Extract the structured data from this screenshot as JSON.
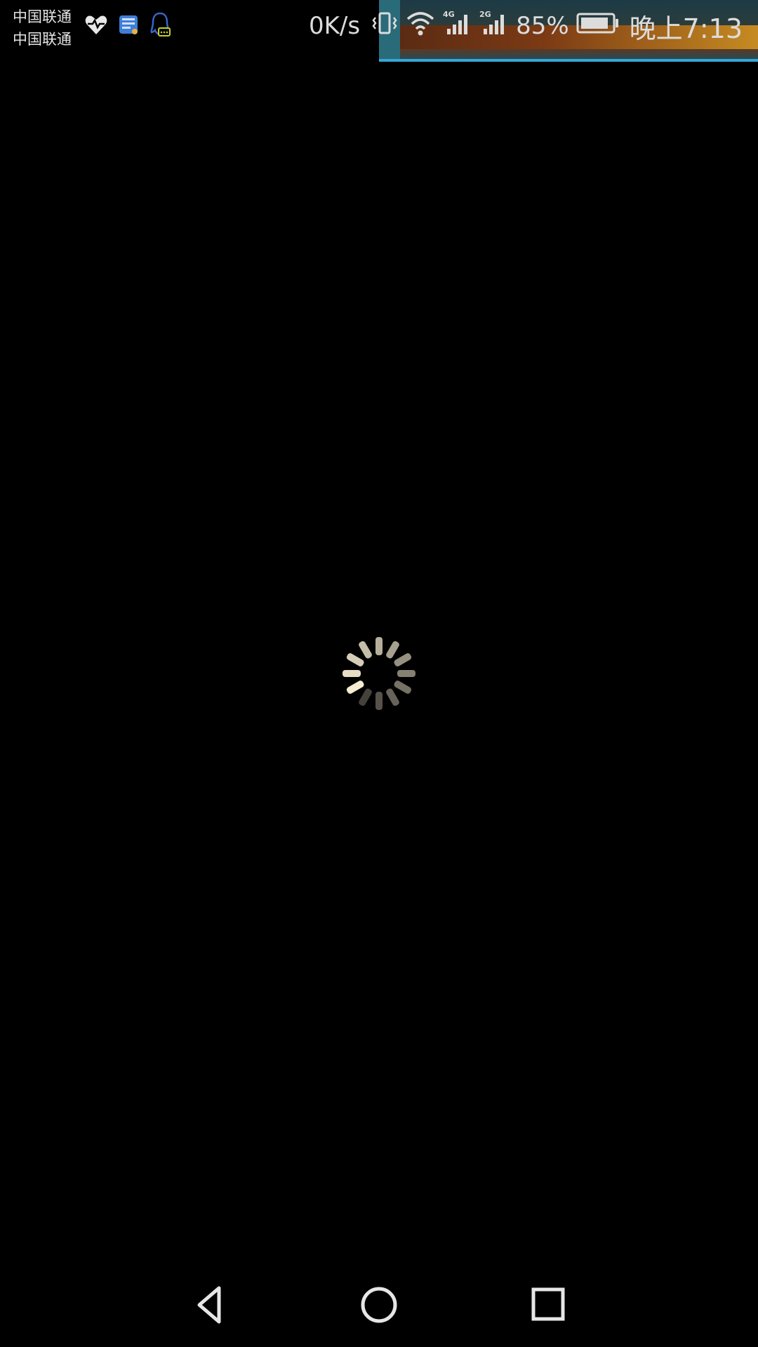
{
  "status_bar": {
    "carrier_1": "中国联通",
    "carrier_2": "中国联通",
    "net_speed": "0K/s",
    "network_1": "4G",
    "network_2": "2G",
    "battery_percent": "85%",
    "time": "晚上7:13",
    "notification_icons": [
      "heart-rate-icon",
      "tieba-icon",
      "qq-icon"
    ]
  },
  "content": {
    "state": "loading",
    "spinner_icon": "loading-spinner-icon"
  },
  "nav_bar": {
    "buttons": [
      "back-icon",
      "home-icon",
      "recent-apps-icon"
    ]
  },
  "colors": {
    "background": "#000000",
    "status_text": "#dcdcdc",
    "banner_border": "#36a7d6"
  }
}
